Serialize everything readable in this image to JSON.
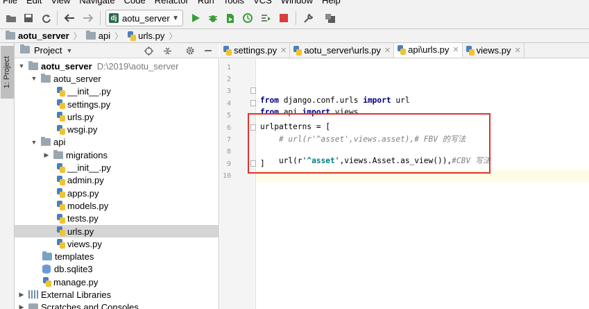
{
  "menu": [
    "File",
    "Edit",
    "View",
    "Navigate",
    "Code",
    "Refactor",
    "Run",
    "Tools",
    "VCS",
    "Window",
    "Help"
  ],
  "toolbar": {
    "run_config": "aotu_server"
  },
  "breadcrumb": [
    "aotu_server",
    "api",
    "urls.py"
  ],
  "tool_strip": {
    "project_label": "1: Project"
  },
  "project_panel": {
    "title": "Project"
  },
  "tree": {
    "root_name": "aotu_server",
    "root_path": "D:\\2019\\aotu_server",
    "aotu_server_folder": "aotu_server",
    "init1": "__init__.py",
    "settings": "settings.py",
    "urls1": "urls.py",
    "wsgi": "wsgi.py",
    "api_folder": "api",
    "migrations": "migrations",
    "init2": "__init__.py",
    "admin": "admin.py",
    "apps": "apps.py",
    "models": "models.py",
    "tests": "tests.py",
    "urls2": "urls.py",
    "views": "views.py",
    "templates": "templates",
    "db": "db.sqlite3",
    "manage": "manage.py",
    "external": "External Libraries",
    "scratches": "Scratches and Consoles"
  },
  "tabs": [
    {
      "label": "settings.py"
    },
    {
      "label": "aotu_server\\urls.py"
    },
    {
      "label": "api\\urls.py"
    },
    {
      "label": "views.py"
    }
  ],
  "line_numbers": [
    "1",
    "2",
    "3",
    "4",
    "5",
    "6",
    "7",
    "8",
    "9",
    "10"
  ],
  "code": {
    "l3_kw1": "from",
    "l3_mod": " django.conf.urls ",
    "l3_kw2": "import",
    "l3_name": " url",
    "l4_kw1": "from",
    "l4_mod": " api ",
    "l4_kw2": "import",
    "l4_name": " views",
    "l6": "urlpatterns = [",
    "l7": "    # url(r'^asset',views.asset),# FBV 的写法",
    "l8_pre": "    url(r'",
    "l8_str": "^asset",
    "l8_mid": "',views.Asset.as_view()),",
    "l8_cm": "#CBV 写法",
    "l9": "]"
  },
  "colors": {
    "annotation_box": "#e03030",
    "keyword": "#000080",
    "comment": "#808080",
    "string": "#008080"
  }
}
